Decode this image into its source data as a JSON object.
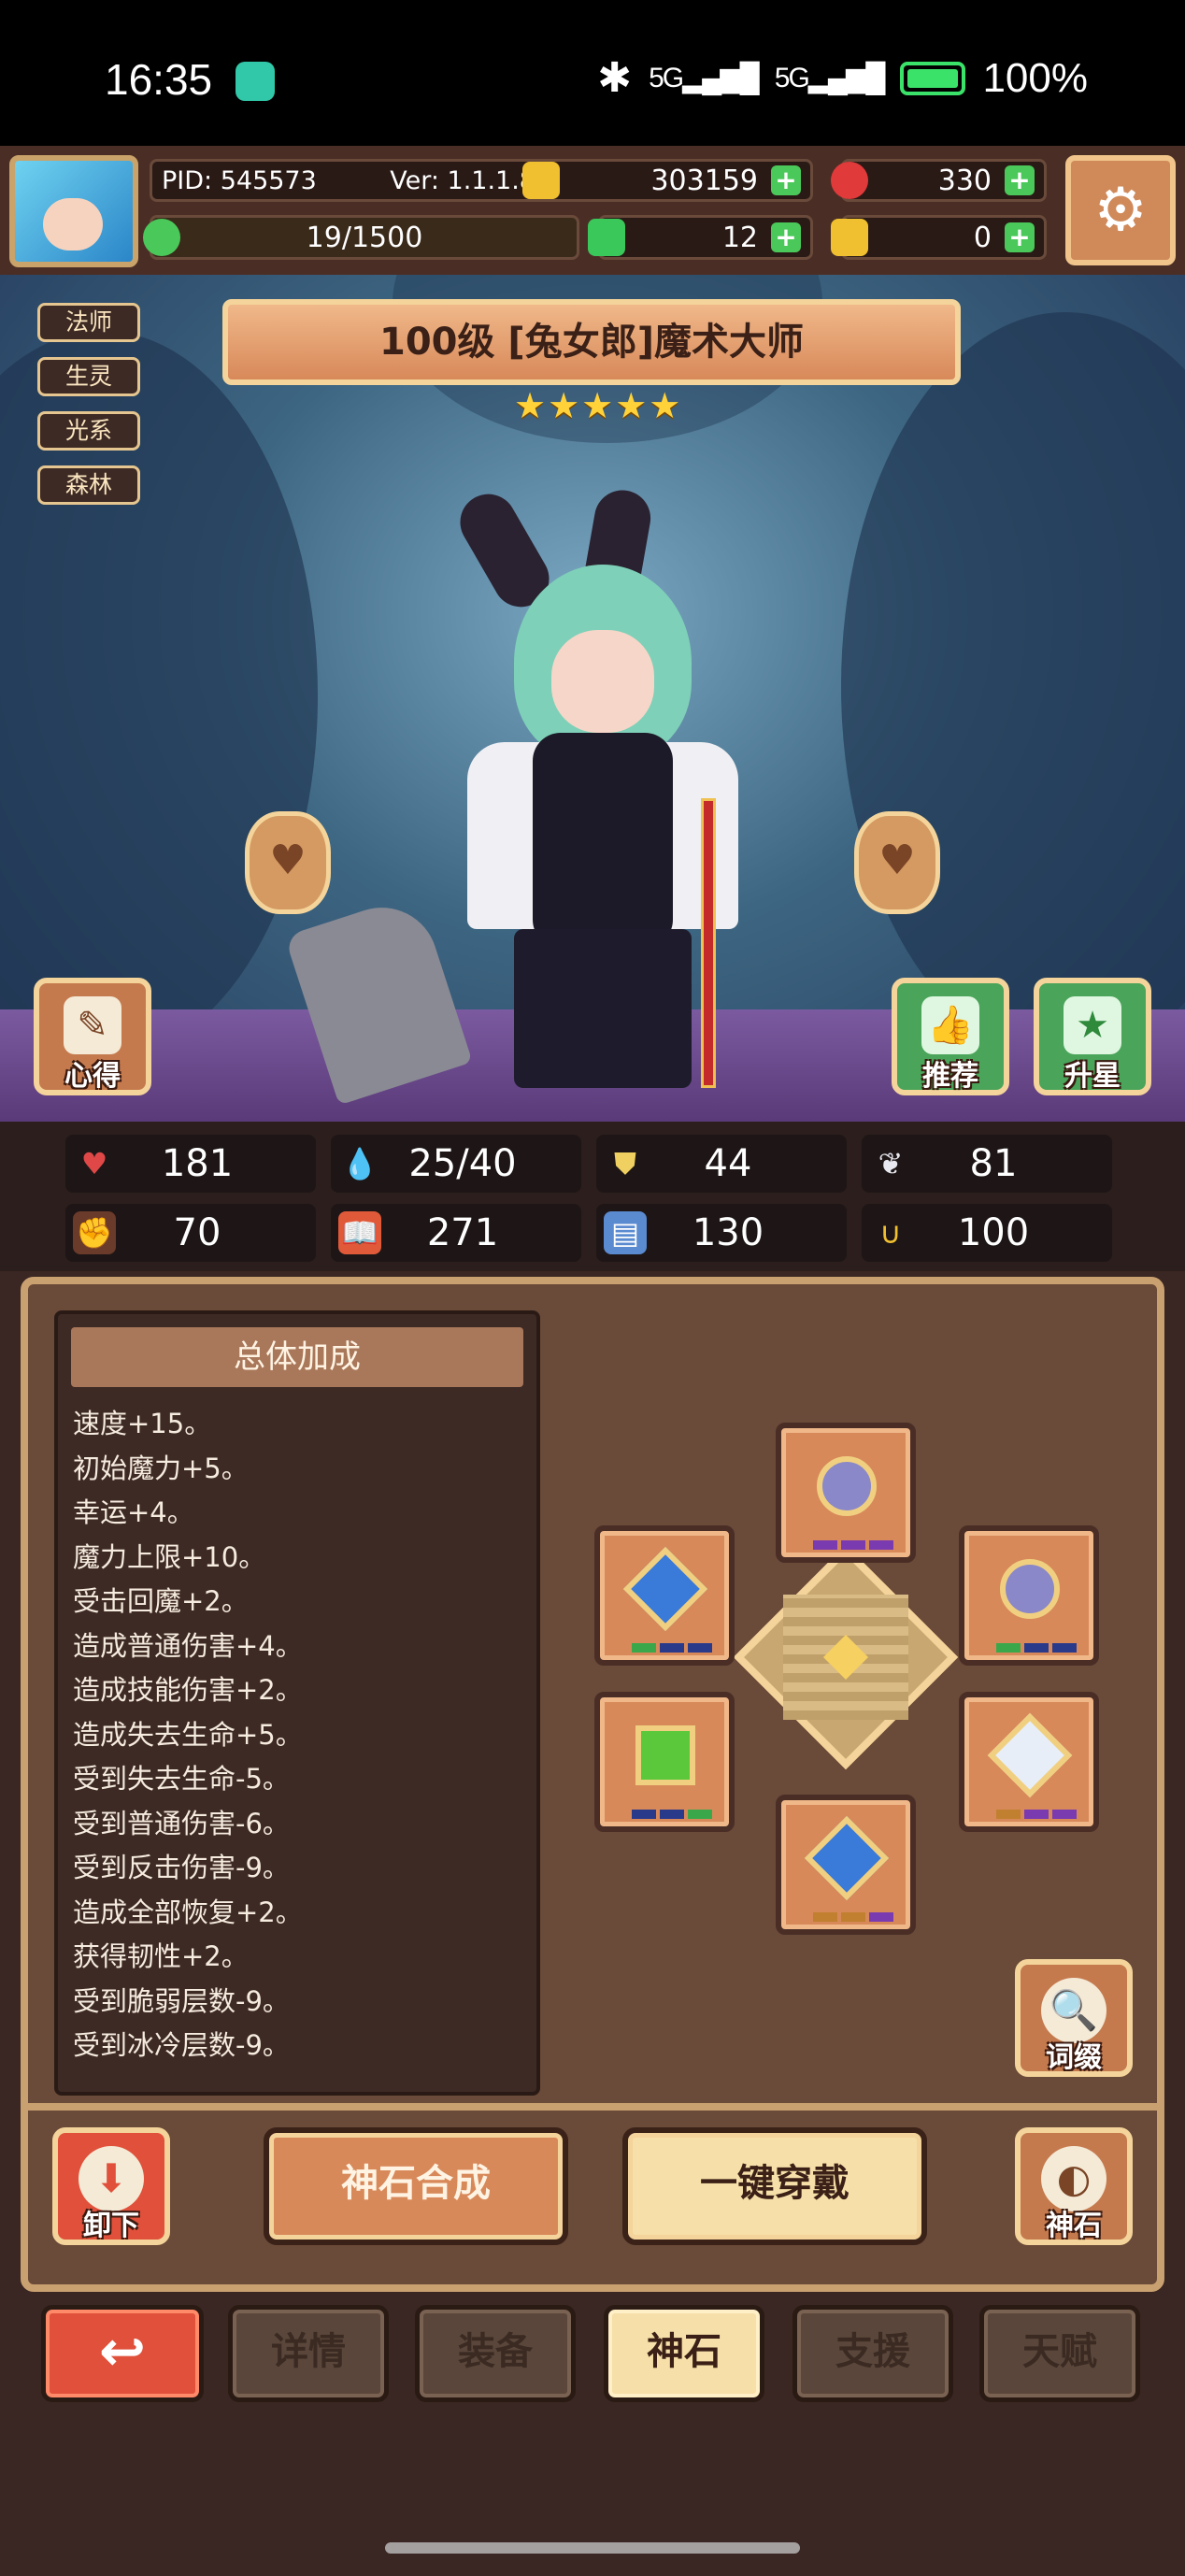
{
  "status_bar": {
    "time": "16:35",
    "signal1": "5G",
    "signal2": "5G",
    "battery": "100%"
  },
  "top_bar": {
    "pid": "PID: 545573",
    "version": "Ver: 1.1.1.8",
    "gold": "303159",
    "red_gems": "330",
    "energy": "19/1500",
    "clovers": "12",
    "keys": "0",
    "plus_symbol": "+",
    "settings_icon": "gear-icon"
  },
  "hero": {
    "tags": [
      "法师",
      "生灵",
      "光系",
      "森林"
    ],
    "title": "100级 [兔女郎]魔术大师",
    "stars": "★★★★★",
    "buttons": {
      "xinde": "心得",
      "tuijian": "推荐",
      "shengxing": "升星"
    }
  },
  "stats": [
    {
      "icon": "heart-icon",
      "value": "181",
      "color": "#e04848"
    },
    {
      "icon": "mana-drop-icon",
      "value": "25/40",
      "color": "#5ab8f0"
    },
    {
      "icon": "shield-icon",
      "value": "44",
      "color": "#f0d060"
    },
    {
      "icon": "wing-icon",
      "value": "81",
      "color": "#e8e8f0"
    },
    {
      "icon": "fist-icon",
      "value": "70",
      "color": "#f0a080"
    },
    {
      "icon": "book-icon",
      "value": "271",
      "color": "#e05a3a"
    },
    {
      "icon": "scroll-icon",
      "value": "130",
      "color": "#5a8ad0"
    },
    {
      "icon": "horseshoe-icon",
      "value": "100",
      "color": "#f0c030"
    }
  ],
  "panel": {
    "bonus_title": "总体加成",
    "bonus_lines": [
      "速度+15。",
      "初始魔力+5。",
      "幸运+4。",
      "魔力上限+10。",
      "受击回魔+2。",
      "造成普通伤害+4。",
      "造成技能伤害+2。",
      "造成失去生命+5。",
      "受到失去生命-5。",
      "受到普通伤害-6。",
      "受到反击伤害-9。",
      "造成全部恢复+2。",
      "获得韧性+2。",
      "受到脆弱层数-9。",
      "受到冰冷层数-9。"
    ],
    "affix_button": "词缀",
    "unequip_button": "卸下",
    "synthesize_button": "神石合成",
    "equip_all_button": "一键穿戴",
    "godstone_button": "神石"
  },
  "tabs": {
    "back_icon": "↩",
    "details": "详情",
    "equipment": "装备",
    "godstone": "神石",
    "support": "支援",
    "talent": "天赋"
  }
}
